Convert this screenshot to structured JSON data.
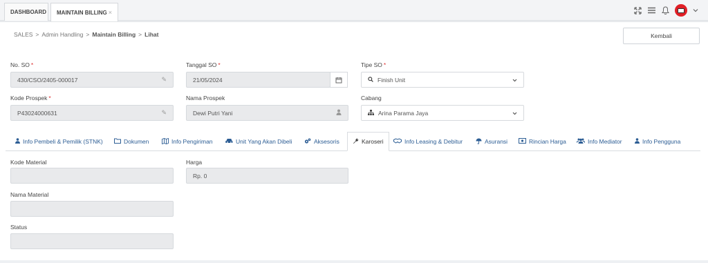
{
  "tabs": [
    {
      "label": "DASHBOARD"
    },
    {
      "label": "MAINTAIN BILLING",
      "close": "×"
    }
  ],
  "topbar_icons": [
    "expand-icon",
    "menu-icon",
    "bell-icon",
    "avatar",
    "chevron-down-icon"
  ],
  "breadcrumb": {
    "items": [
      "SALES",
      "Admin Handling",
      "Maintain Billing",
      "Lihat"
    ],
    "separator": ">"
  },
  "back_button": "Kembali",
  "form": {
    "no_so": {
      "label": "No. SO",
      "required": "*",
      "value": "430/CSO/2405-000017"
    },
    "tanggal_so": {
      "label": "Tanggal SO",
      "required": "*",
      "value": "21/05/2024"
    },
    "tipe_so": {
      "label": "Tipe SO",
      "required": "*",
      "value": "Finish Unit"
    },
    "kode_prospek": {
      "label": "Kode Prospek",
      "required": "*",
      "value": "P43024000631"
    },
    "nama_prospek": {
      "label": "Nama Prospek",
      "value": "Dewi Putri Yani"
    },
    "cabang": {
      "label": "Cabang",
      "value": "Arina Parama Jaya"
    }
  },
  "subtabs": [
    {
      "label": "Info Pembeli & Pemilik (STNK)",
      "icon": "user-icon"
    },
    {
      "label": "Dokumen",
      "icon": "folder-icon"
    },
    {
      "label": "Info Pengiriman",
      "icon": "map-icon"
    },
    {
      "label": "Unit Yang Akan Dibeli",
      "icon": "car-icon"
    },
    {
      "label": "Aksesoris",
      "icon": "cogs-icon"
    },
    {
      "label": "Karoseri",
      "icon": "wrench-icon",
      "active": true
    },
    {
      "label": "Info Leasing & Debitur",
      "icon": "handshake-icon"
    },
    {
      "label": "Asuransi",
      "icon": "umbrella-icon"
    },
    {
      "label": "Rincian Harga",
      "icon": "money-icon"
    },
    {
      "label": "Info Mediator",
      "icon": "users-icon"
    },
    {
      "label": "Info Pengguna",
      "icon": "user-icon"
    }
  ],
  "karoseri": {
    "kode_material": {
      "label": "Kode Material",
      "value": ""
    },
    "harga": {
      "label": "Harga",
      "value": "Rp. 0"
    },
    "nama_material": {
      "label": "Nama Material",
      "value": ""
    },
    "status": {
      "label": "Status",
      "value": ""
    }
  }
}
